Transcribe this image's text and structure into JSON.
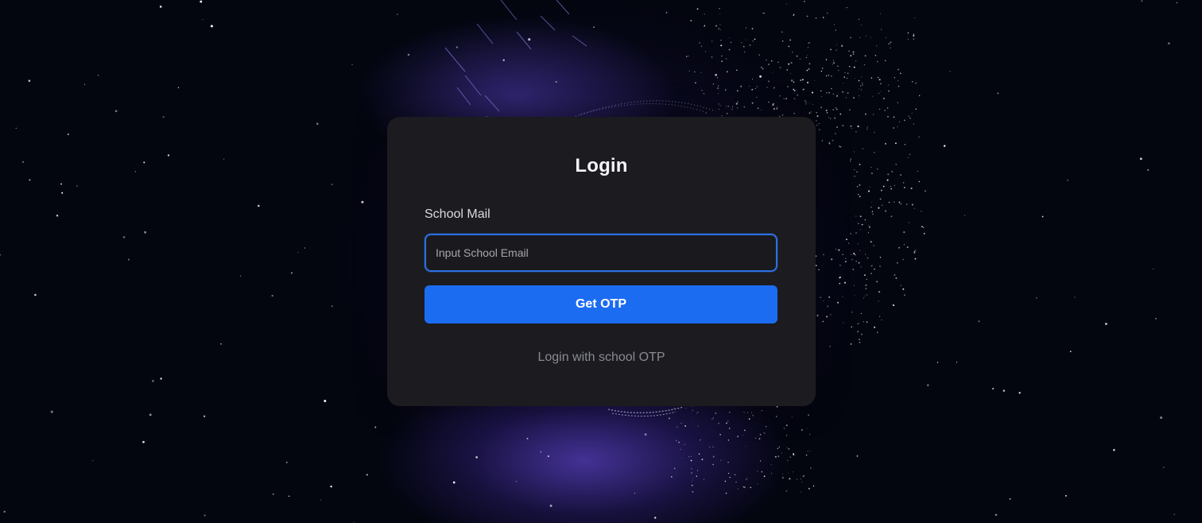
{
  "login": {
    "title": "Login",
    "email_label": "School Mail",
    "email_placeholder": "Input School Email",
    "email_value": "",
    "submit_label": "Get OTP",
    "alt_link_label": "Login with school OTP"
  },
  "colors": {
    "background": "#03050f",
    "card": "#1b1b20",
    "accent": "#1c6cf2",
    "input_border": "#2d6fe0",
    "nebula": "#5840be"
  }
}
